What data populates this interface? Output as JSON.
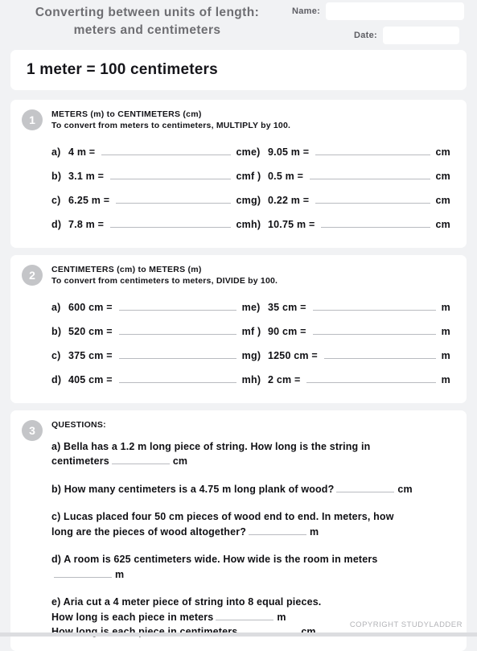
{
  "header": {
    "title_line_1": "Converting between units of length:",
    "title_line_2": "meters and centimeters",
    "name_label": "Name:",
    "name_value": "",
    "name_placeholder": "",
    "date_label": "Date:",
    "date_value": "",
    "date_placeholder": ""
  },
  "banner": {
    "text": "1 meter = 100 centimeters"
  },
  "sections": [
    {
      "badge": "1",
      "title": "METERS (m) to CENTIMETERS (cm)",
      "subtitle": "To convert from meters to centimeters, MULTIPLY by 100.",
      "rows": [
        {
          "left": {
            "label": "a)",
            "expr": "4 m =",
            "unit": "cm"
          },
          "right": {
            "label": "e)",
            "expr": "9.05 m =",
            "unit": "cm"
          }
        },
        {
          "left": {
            "label": "b)",
            "expr": "3.1 m =",
            "unit": "cm"
          },
          "right": {
            "label": "f )",
            "expr": "0.5 m =",
            "unit": "cm"
          }
        },
        {
          "left": {
            "label": "c)",
            "expr": "6.25 m =",
            "unit": "cm"
          },
          "right": {
            "label": "g)",
            "expr": "0.22 m =",
            "unit": "cm"
          }
        },
        {
          "left": {
            "label": "d)",
            "expr": "7.8 m =",
            "unit": "cm"
          },
          "right": {
            "label": "h)",
            "expr": "10.75 m =",
            "unit": "cm"
          }
        }
      ]
    },
    {
      "badge": "2",
      "title": "CENTIMETERS (cm) to METERS (m)",
      "subtitle": "To convert from centimeters to meters, DIVIDE by 100.",
      "rows": [
        {
          "left": {
            "label": "a)",
            "expr": "600 cm =",
            "unit": "m"
          },
          "right": {
            "label": "e)",
            "expr": "35 cm =",
            "unit": "m"
          }
        },
        {
          "left": {
            "label": "b)",
            "expr": "520 cm =",
            "unit": "m"
          },
          "right": {
            "label": "f )",
            "expr": "90 cm =",
            "unit": "m"
          }
        },
        {
          "left": {
            "label": "c)",
            "expr": "375 cm =",
            "unit": "m"
          },
          "right": {
            "label": "g)",
            "expr": "1250 cm  =",
            "unit": "m"
          }
        },
        {
          "left": {
            "label": "d)",
            "expr": "405 cm =",
            "unit": "m"
          },
          "right": {
            "label": "h)",
            "expr": "2 cm =",
            "unit": "m"
          }
        }
      ]
    }
  ],
  "questions_section": {
    "badge": "3",
    "title": "QUESTIONS:",
    "items": [
      {
        "lines": [
          {
            "text": "a) Bella has a 1.2 m long piece of string. How long is the string in",
            "blank": false,
            "unit": ""
          },
          {
            "text": "centimeters",
            "blank": true,
            "unit": "cm"
          }
        ]
      },
      {
        "lines": [
          {
            "text": "b) How many centimeters is a 4.75 m long plank of wood?",
            "blank": true,
            "unit": "cm"
          }
        ]
      },
      {
        "lines": [
          {
            "text": "c) Lucas placed four 50 cm pieces of wood end to end. In meters, how",
            "blank": false,
            "unit": ""
          },
          {
            "text": "long are the pieces of wood altogether?",
            "blank": true,
            "unit": "m"
          }
        ]
      },
      {
        "lines": [
          {
            "text": "d) A room is 625 centimeters wide. How wide is the room in meters",
            "blank": false,
            "unit": ""
          },
          {
            "text": "",
            "blank": true,
            "unit": "m"
          }
        ]
      },
      {
        "lines": [
          {
            "text": "e) Aria cut a 4 meter piece of string into 8 equal pieces.",
            "blank": false,
            "unit": ""
          },
          {
            "text": "How long is each piece in meters",
            "blank": true,
            "unit": "m"
          },
          {
            "text": "How long is each piece in centimeters",
            "blank": true,
            "unit": "cm"
          }
        ]
      }
    ]
  },
  "footer": {
    "copyright": "COPYRIGHT STUDYLADDER"
  },
  "colors": {
    "page_background": "#f1f2f4",
    "card_background": "#ffffff",
    "title_text": "#6e6e72",
    "body_text": "#101014",
    "badge_background": "#c4c5c8",
    "blank_line": "#b9bbc0",
    "footer_text": "#b2b3b7"
  }
}
